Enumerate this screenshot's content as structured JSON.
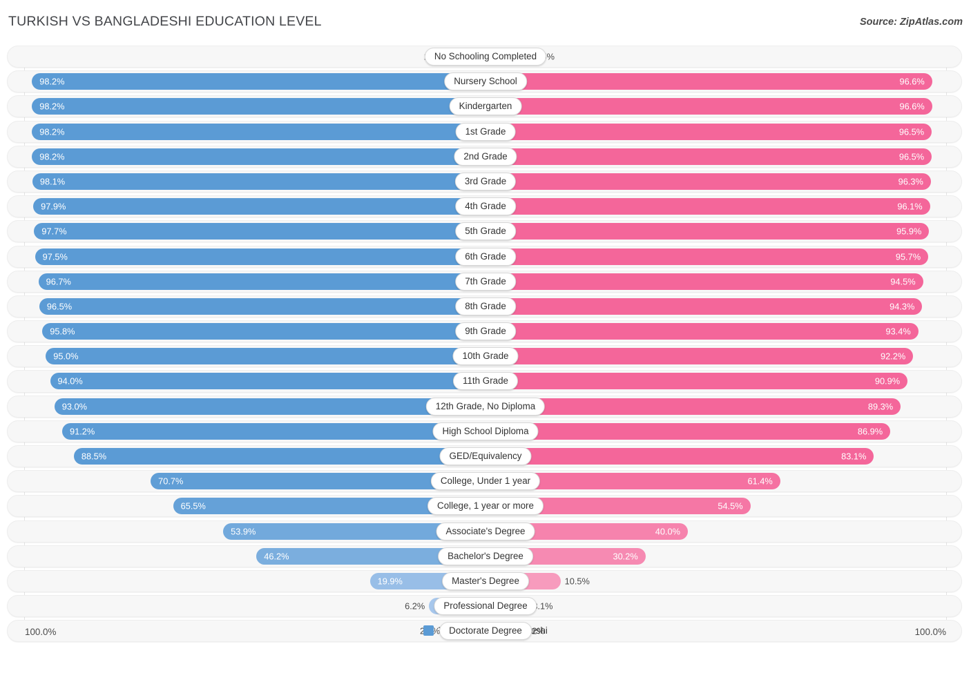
{
  "header": {
    "title": "TURKISH VS BANGLADESHI EDUCATION LEVEL",
    "source": "Source: ZipAtlas.com"
  },
  "footer": {
    "axis_left": "100.0%",
    "axis_right": "100.0%",
    "legend": [
      {
        "label": "Turkish",
        "color": "#5B9BD5"
      },
      {
        "label": "Bangladeshi",
        "color": "#F4669A"
      }
    ]
  },
  "colors": {
    "turkish_strong": "#5B9BD5",
    "turkish_light": "#A8C8EC",
    "bangladeshi_strong": "#F4669A",
    "bangladeshi_light": "#F79FC0",
    "track": "#F7F7F7",
    "gridline": "#E3E3E3"
  },
  "chart_data": {
    "type": "bar",
    "subtype": "diverging-paired-bar",
    "title": "TURKISH VS BANGLADESHI EDUCATION LEVEL",
    "xlabel": "",
    "ylabel": "",
    "xlim": [
      100.0,
      100.0
    ],
    "grid": true,
    "legend_position": "bottom-center",
    "categories": [
      "No Schooling Completed",
      "Nursery School",
      "Kindergarten",
      "1st Grade",
      "2nd Grade",
      "3rd Grade",
      "4th Grade",
      "5th Grade",
      "6th Grade",
      "7th Grade",
      "8th Grade",
      "9th Grade",
      "10th Grade",
      "11th Grade",
      "12th Grade, No Diploma",
      "High School Diploma",
      "GED/Equivalency",
      "College, Under 1 year",
      "College, 1 year or more",
      "Associate's Degree",
      "Bachelor's Degree",
      "Master's Degree",
      "Professional Degree",
      "Doctorate Degree"
    ],
    "series": [
      {
        "name": "Turkish",
        "color": "#5B9BD5",
        "side": "left",
        "values": [
          1.8,
          98.2,
          98.2,
          98.2,
          98.2,
          98.1,
          97.9,
          97.7,
          97.5,
          96.7,
          96.5,
          95.8,
          95.0,
          94.0,
          93.0,
          91.2,
          88.5,
          70.7,
          65.5,
          53.9,
          46.2,
          19.9,
          6.2,
          2.7
        ],
        "labels": [
          "1.8%",
          "98.2%",
          "98.2%",
          "98.2%",
          "98.2%",
          "98.1%",
          "97.9%",
          "97.7%",
          "97.5%",
          "96.7%",
          "96.5%",
          "95.8%",
          "95.0%",
          "94.0%",
          "93.0%",
          "91.2%",
          "88.5%",
          "70.7%",
          "65.5%",
          "53.9%",
          "46.2%",
          "19.9%",
          "6.2%",
          "2.7%"
        ]
      },
      {
        "name": "Bangladeshi",
        "color": "#F4669A",
        "side": "right",
        "values": [
          3.5,
          96.6,
          96.6,
          96.5,
          96.5,
          96.3,
          96.1,
          95.9,
          95.7,
          94.5,
          94.3,
          93.4,
          92.2,
          90.9,
          89.3,
          86.9,
          83.1,
          61.4,
          54.5,
          40.0,
          30.2,
          10.5,
          3.1,
          1.2
        ],
        "labels": [
          "3.5%",
          "96.6%",
          "96.6%",
          "96.5%",
          "96.5%",
          "96.3%",
          "96.1%",
          "95.9%",
          "95.7%",
          "94.5%",
          "94.3%",
          "93.4%",
          "92.2%",
          "90.9%",
          "89.3%",
          "86.9%",
          "83.1%",
          "61.4%",
          "54.5%",
          "40.0%",
          "30.2%",
          "10.5%",
          "3.1%",
          "1.2%"
        ]
      }
    ]
  }
}
